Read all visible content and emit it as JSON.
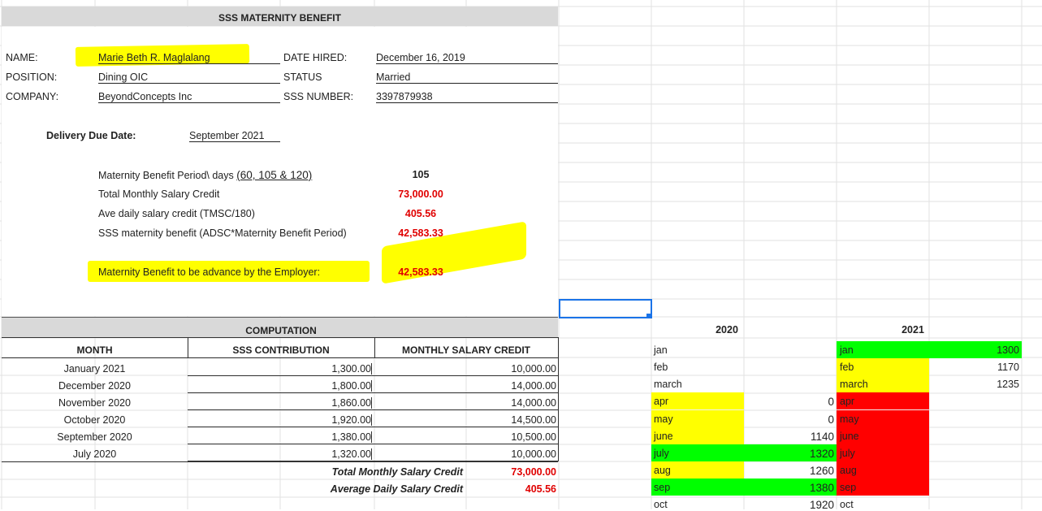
{
  "form": {
    "title": "SSS MATERNITY BENEFIT",
    "name_label": "NAME:",
    "name_value": "Marie Beth R. Maglalang",
    "position_label": "POSITION:",
    "position_value": "Dining OIC",
    "company_label": "COMPANY:",
    "company_value": "BeyondConcepts Inc",
    "date_hired_label": "DATE HIRED:",
    "date_hired_value": "December 16, 2019",
    "status_label": "STATUS",
    "status_value": "Married",
    "sss_label": "SSS NUMBER:",
    "sss_value": "3397879938",
    "due_label": "Delivery Due Date:",
    "due_value": "September 2021"
  },
  "summary": {
    "period_label": "Maternity Benefit Period\\ days ",
    "period_options": "(60, 105 & 120)",
    "period_value": "105",
    "tmsc_label": "Total Monthly Salary Credit",
    "tmsc_value": "73,000.00",
    "adsc_label": "Ave daily salary credit (TMSC/180)",
    "adsc_value": "405.56",
    "benefit_label": "SSS maternity benefit (ADSC*Maternity Benefit Period)",
    "benefit_value": "42,583.33",
    "advance_label": "Maternity Benefit to be advance by the Employer:",
    "advance_value": "42,583.33"
  },
  "computation": {
    "title": "COMPUTATION",
    "col_month": "MONTH",
    "col_contrib": "SSS CONTRIBUTION",
    "col_msc": "MONTHLY SALARY CREDIT",
    "rows": [
      {
        "month": "January 2021",
        "contrib": "1,300.00",
        "msc": "10,000.00"
      },
      {
        "month": "December 2020",
        "contrib": "1,800.00",
        "msc": "14,000.00"
      },
      {
        "month": "November 2020",
        "contrib": "1,860.00",
        "msc": "14,000.00"
      },
      {
        "month": "October 2020",
        "contrib": "1,920.00",
        "msc": "14,500.00"
      },
      {
        "month": "September 2020",
        "contrib": "1,380.00",
        "msc": "10,500.00"
      },
      {
        "month": "July 2020",
        "contrib": "1,320.00",
        "msc": "10,000.00"
      }
    ],
    "total_label": "Total Monthly Salary Credit",
    "total_value": "73,000.00",
    "avg_label": "Average Daily Salary Credit",
    "avg_value": "405.56"
  },
  "side": {
    "year_2020": "2020",
    "year_2021": "2021",
    "months_2020": [
      "jan",
      "feb",
      "march",
      "apr",
      "may",
      "june",
      "july",
      "aug",
      "sep",
      "oct"
    ],
    "values_2020": [
      "",
      "",
      "",
      "0",
      "0",
      "1140",
      "1320",
      "1260",
      "1380",
      "1920"
    ],
    "fill_2020": [
      "",
      "",
      "",
      "#ffff00",
      "#ffff00",
      "#ffff00",
      "#00ff00",
      "#ffff00",
      "#00ff00",
      ""
    ],
    "months_2021": [
      "jan",
      "feb",
      "march",
      "apr",
      "may",
      "june",
      "july",
      "aug",
      "sep",
      "oct"
    ],
    "values_2021": [
      "1300",
      "1170",
      "1235",
      "",
      "",
      "",
      "",
      "",
      "",
      ""
    ],
    "fill_2021": [
      "#00ff00",
      "#ffff00",
      "#ffff00",
      "#ff0000",
      "#ff0000",
      "#ff0000",
      "#ff0000",
      "#ff0000",
      "#ff0000",
      ""
    ]
  },
  "colors": {
    "highlight": "#ffff00",
    "green": "#00ff00",
    "red": "#ff0000",
    "value_red": "#e00000",
    "selection": "#1a73e8"
  }
}
